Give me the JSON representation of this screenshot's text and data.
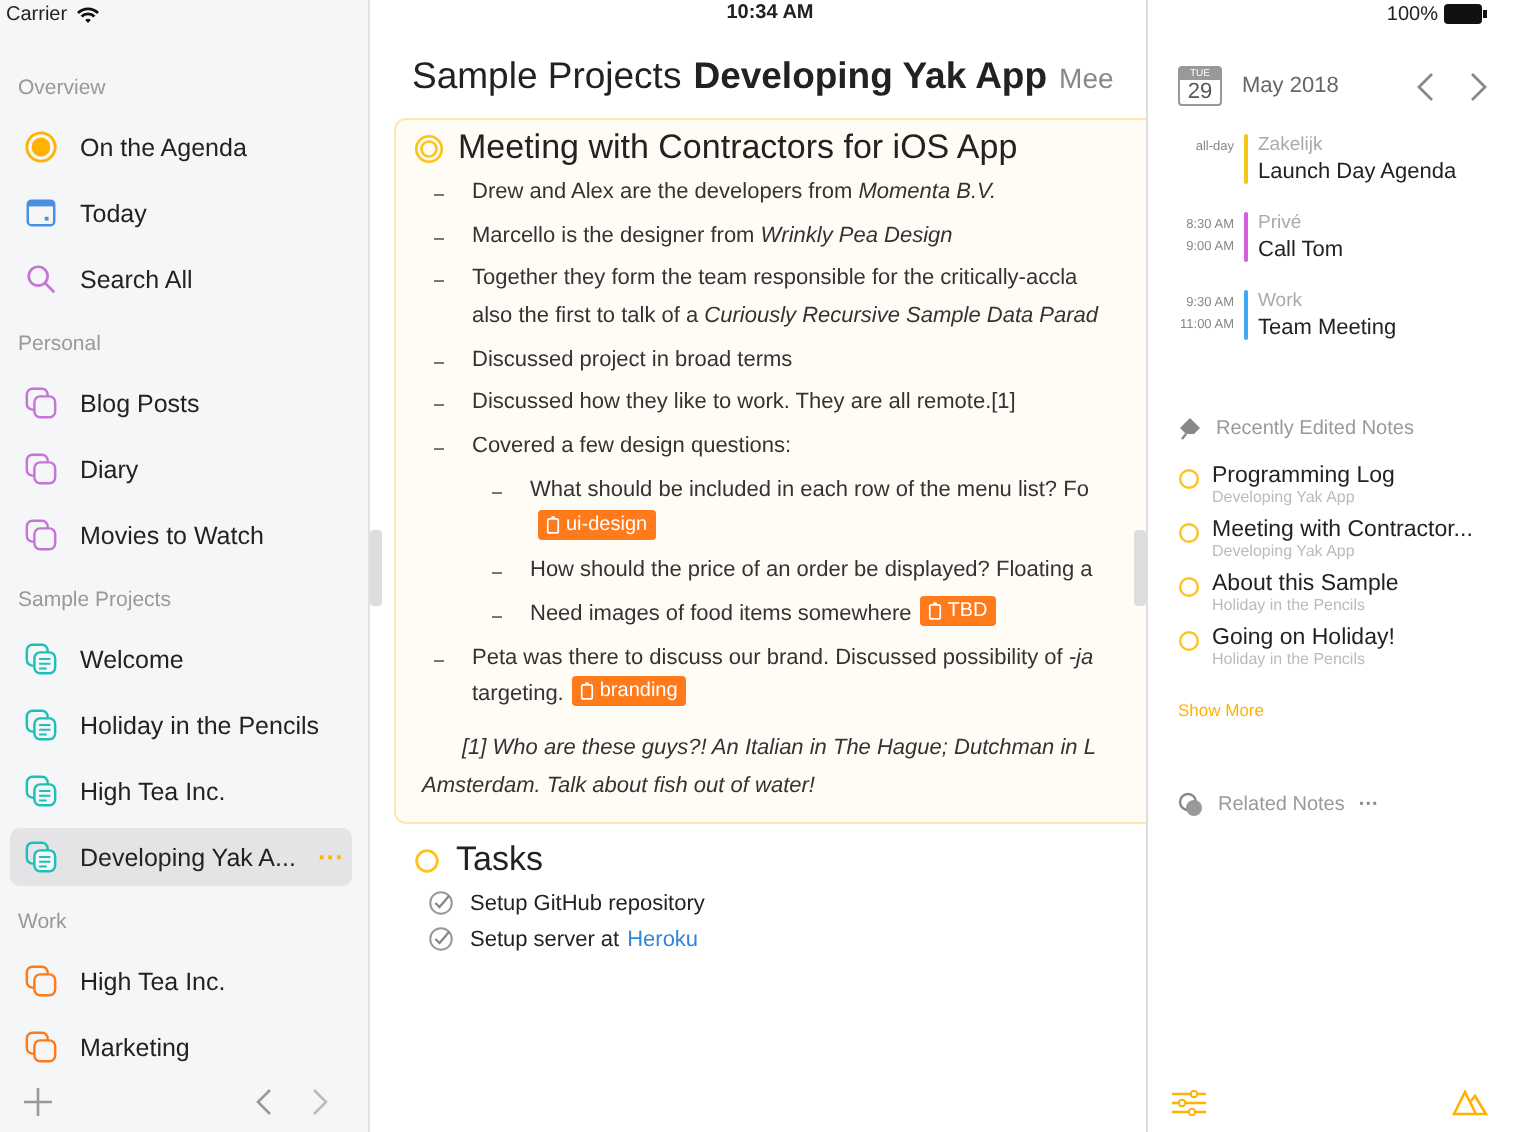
{
  "status_bar": {
    "carrier": "Carrier",
    "time": "10:34 AM",
    "battery": "100%"
  },
  "sidebar": {
    "sections": [
      {
        "title": "Overview",
        "items": [
          {
            "label": "On the Agenda",
            "kind": "agenda",
            "color": "#ffb300",
            "selected": false
          },
          {
            "label": "Today",
            "kind": "today",
            "color": "#4a90e2",
            "selected": false
          },
          {
            "label": "Search All",
            "kind": "search",
            "color": "#c774d9",
            "selected": false
          }
        ]
      },
      {
        "title": "Personal",
        "items": [
          {
            "label": "Blog Posts",
            "kind": "folder",
            "color": "#c774d9",
            "selected": false
          },
          {
            "label": "Diary",
            "kind": "folder",
            "color": "#c774d9",
            "selected": false
          },
          {
            "label": "Movies to Watch",
            "kind": "folder",
            "color": "#c774d9",
            "selected": false
          }
        ]
      },
      {
        "title": "Sample Projects",
        "items": [
          {
            "label": "Welcome",
            "kind": "project",
            "color": "#1fbfb8",
            "selected": false
          },
          {
            "label": "Holiday in the Pencils",
            "kind": "project",
            "color": "#1fbfb8",
            "selected": false
          },
          {
            "label": "High Tea Inc.",
            "kind": "project",
            "color": "#1fbfb8",
            "selected": false
          },
          {
            "label": "Developing Yak A...",
            "kind": "project",
            "color": "#1fbfb8",
            "selected": true
          }
        ]
      },
      {
        "title": "Work",
        "items": [
          {
            "label": "High Tea Inc.",
            "kind": "folder",
            "color": "#ff7a1a",
            "selected": false
          },
          {
            "label": "Marketing",
            "kind": "folder",
            "color": "#ff7a1a",
            "selected": false
          }
        ]
      }
    ]
  },
  "header": {
    "parent": "Sample Projects",
    "title": "Developing Yak App",
    "next": "Mee"
  },
  "note": {
    "title": "Meeting with Contractors for iOS App",
    "bullets": [
      {
        "lines": [
          "Drew and Alex are the developers from *Momenta B.V.*"
        ]
      },
      {
        "lines": [
          "Marcello is the designer from *Wrinkly Pea Design*"
        ]
      },
      {
        "lines": [
          "Together they form the team responsible for the critically-accla",
          "also the first to talk of a *Curiously Recursive Sample Data Parad*"
        ]
      },
      {
        "lines": [
          "Discussed project in broad terms"
        ]
      },
      {
        "lines": [
          "Discussed how they like to work. They are all remote.[1]"
        ]
      },
      {
        "lines": [
          "Covered a few design questions:"
        ],
        "children": [
          {
            "lines": [
              "What should be included in each row of the menu list? Fo"
            ],
            "tag": "ui-design"
          },
          {
            "lines": [
              "How should the price of an order be displayed? Floating a"
            ]
          },
          {
            "lines": [
              "Need images of food items somewhere"
            ],
            "tag": "TBD"
          }
        ]
      },
      {
        "lines": [
          "Peta was there to discuss our brand. Discussed possibility of *-ja*",
          "targeting."
        ],
        "tag": "branding"
      }
    ],
    "footnote": [
      "[1] Who are these guys?! An Italian in The Hague; Dutchman in L",
      "Amsterdam. Talk about fish out of water!"
    ]
  },
  "tasks": {
    "title": "Tasks",
    "items": [
      {
        "text": "Setup GitHub repository",
        "done": true
      },
      {
        "text": "Setup server at",
        "link": "Heroku",
        "done": true
      }
    ]
  },
  "calendar": {
    "weekday": "TUE",
    "day": "29",
    "month": "May 2018",
    "events": [
      {
        "start": "all-day",
        "calendar": "Zakelijk",
        "title": "Launch Day Agenda",
        "color": "#f5c518"
      },
      {
        "start": "8:30 AM",
        "end": "9:00 AM",
        "calendar": "Privé",
        "title": "Call Tom",
        "color": "#d35ee0"
      },
      {
        "start": "9:30 AM",
        "end": "11:00 AM",
        "calendar": "Work",
        "title": "Team Meeting",
        "color": "#3fa9f5"
      }
    ]
  },
  "recent": {
    "title": "Recently Edited Notes",
    "notes": [
      {
        "title": "Programming Log",
        "project": "Developing Yak App"
      },
      {
        "title": "Meeting with Contractor...",
        "project": "Developing Yak App"
      },
      {
        "title": "About this Sample",
        "project": "Holiday in the Pencils"
      },
      {
        "title": "Going on Holiday!",
        "project": "Holiday in the Pencils"
      }
    ],
    "show_more": "Show More"
  },
  "related": {
    "title": "Related Notes",
    "more": "···"
  },
  "sidebar_menu": "···"
}
